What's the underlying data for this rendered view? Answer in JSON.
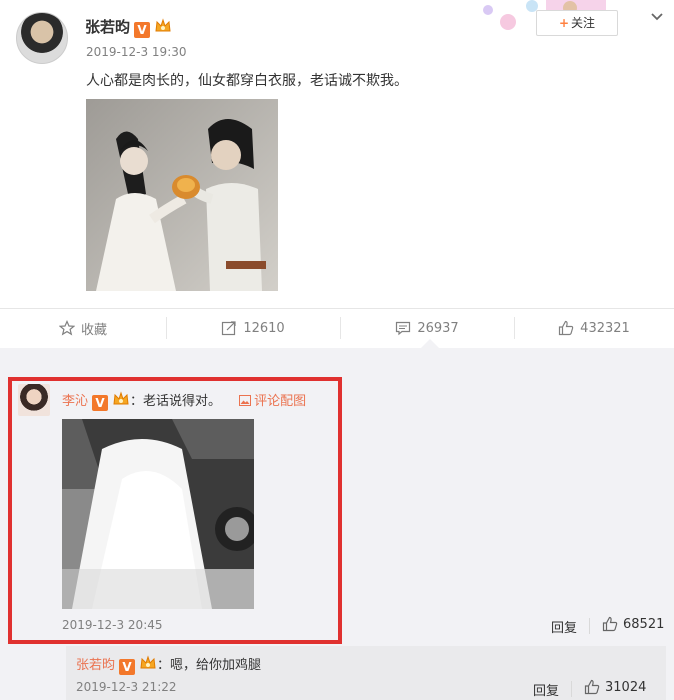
{
  "post": {
    "username": "张若昀",
    "verified_badge": "V",
    "timestamp": "2019-12-3 19:30",
    "text": "人心都是肉长的，仙女都穿白衣服，老话诚不欺我。",
    "image_icon": "photo-couple",
    "follow_label": "关注",
    "follow_icon": "plus-icon",
    "menu_icon": "chevron-down-icon"
  },
  "actions": {
    "favorite_label": "收藏",
    "repost_count": "12610",
    "comment_count": "26937",
    "like_count": "432321"
  },
  "comment1": {
    "username": "李沁",
    "verified_badge": "V",
    "text": "：老话说得对。",
    "pic_link": "评论配图",
    "timestamp": "2019-12-3 20:45",
    "reply_label": "回复",
    "like_count": "68521"
  },
  "reply1": {
    "username": "张若昀",
    "verified_badge": "V",
    "text": "：嗯，给你加鸡腿",
    "timestamp": "2019-12-3 21:22",
    "reply_label": "回复",
    "like_count": "31024"
  },
  "colors": {
    "accent_orange": "#eb7350",
    "highlight_box": "#e0312f",
    "verified": "#f3782b"
  }
}
